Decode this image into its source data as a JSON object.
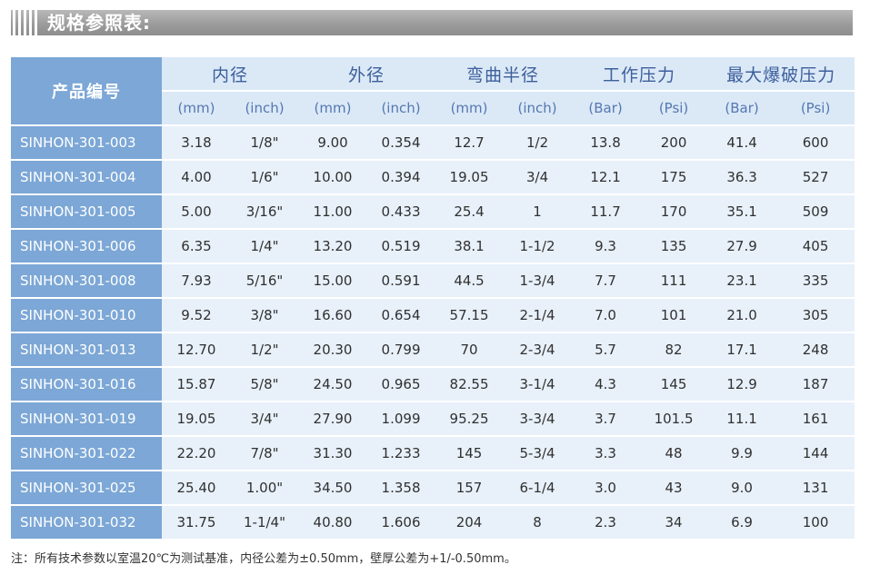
{
  "title": "规格参照表:",
  "headers": {
    "product_code": "产品编号",
    "groups": [
      "内径",
      "外径",
      "弯曲半径",
      "工作压力",
      "最大爆破压力"
    ],
    "units": [
      "(mm)",
      "(inch)",
      "(mm)",
      "(inch)",
      "(mm)",
      "(inch)",
      "(Bar)",
      "(Psi)",
      "(Bar)",
      "(Psi)"
    ]
  },
  "rows": [
    [
      "SINHON-301-003",
      "3.18",
      "1/8\"",
      "9.00",
      "0.354",
      "12.7",
      "1/2",
      "13.8",
      "200",
      "41.4",
      "600"
    ],
    [
      "SINHON-301-004",
      "4.00",
      "1/6\"",
      "10.00",
      "0.394",
      "19.05",
      "3/4",
      "12.1",
      "175",
      "36.3",
      "527"
    ],
    [
      "SINHON-301-005",
      "5.00",
      "3/16\"",
      "11.00",
      "0.433",
      "25.4",
      "1",
      "11.7",
      "170",
      "35.1",
      "509"
    ],
    [
      "SINHON-301-006",
      "6.35",
      "1/4\"",
      "13.20",
      "0.519",
      "38.1",
      "1-1/2",
      "9.3",
      "135",
      "27.9",
      "405"
    ],
    [
      "SINHON-301-008",
      "7.93",
      "5/16\"",
      "15.00",
      "0.591",
      "44.5",
      "1-3/4",
      "7.7",
      "111",
      "23.1",
      "335"
    ],
    [
      "SINHON-301-010",
      "9.52",
      "3/8\"",
      "16.60",
      "0.654",
      "57.15",
      "2-1/4",
      "7.0",
      "101",
      "21.0",
      "305"
    ],
    [
      "SINHON-301-013",
      "12.70",
      "1/2\"",
      "20.30",
      "0.799",
      "70",
      "2-3/4",
      "5.7",
      "82",
      "17.1",
      "248"
    ],
    [
      "SINHON-301-016",
      "15.87",
      "5/8\"",
      "24.50",
      "0.965",
      "82.55",
      "3-1/4",
      "4.3",
      "145",
      "12.9",
      "187"
    ],
    [
      "SINHON-301-019",
      "19.05",
      "3/4\"",
      "27.90",
      "1.099",
      "95.25",
      "3-3/4",
      "3.7",
      "101.5",
      "11.1",
      "161"
    ],
    [
      "SINHON-301-022",
      "22.20",
      "7/8\"",
      "31.30",
      "1.233",
      "145",
      "5-3/4",
      "3.3",
      "48",
      "9.9",
      "144"
    ],
    [
      "SINHON-301-025",
      "25.40",
      "1.00\"",
      "34.50",
      "1.358",
      "157",
      "6-1/4",
      "3.0",
      "43",
      "9.0",
      "131"
    ],
    [
      "SINHON-301-032",
      "31.75",
      "1-1/4\"",
      "40.80",
      "1.606",
      "204",
      "8",
      "2.3",
      "34",
      "6.9",
      "100"
    ]
  ],
  "note": "注：所有技术参数以室温20℃为测试基准，内径公差为±0.50mm，壁厚公差为+1/-0.50mm。"
}
